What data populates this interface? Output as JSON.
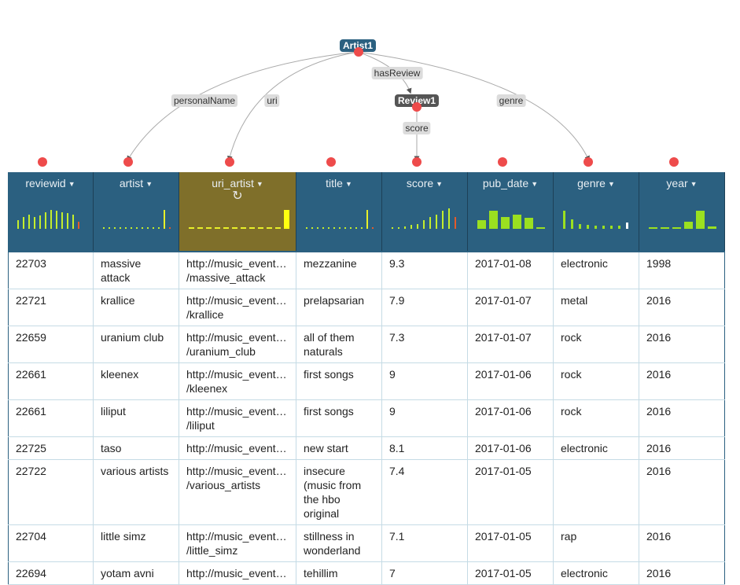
{
  "graph": {
    "nodes": [
      {
        "id": "artist1",
        "label": "Artist1",
        "color": "#2b6080"
      },
      {
        "id": "review1",
        "label": "Review1",
        "color": "#555555"
      }
    ],
    "edge_labels": [
      "personalName",
      "uri",
      "hasReview",
      "genre",
      "score"
    ]
  },
  "table": {
    "columns": [
      {
        "key": "reviewid",
        "label": "reviewid",
        "hist": [
          0.35,
          0.5,
          0.6,
          0.5,
          0.55,
          0.7,
          0.8,
          0.75,
          0.7,
          0.65,
          0.6,
          0.3
        ],
        "hist_colors": [
          "#c4ee2c",
          "#c4ee2c",
          "#c4ee2c",
          "#c4ee2c",
          "#c4ee2c",
          "#c4ee2c",
          "#c4ee2c",
          "#c4ee2c",
          "#c4ee2c",
          "#c4ee2c",
          "#c4ee2c",
          "#e55a2a"
        ],
        "style": "thin"
      },
      {
        "key": "artist",
        "label": "artist",
        "hist": [
          0.08,
          0.08,
          0.08,
          0.08,
          0.08,
          0.08,
          0.08,
          0.08,
          0.08,
          0.08,
          0.08,
          0.8,
          0.05
        ],
        "hist_colors": [
          "#c4ee2c",
          "#c4ee2c",
          "#c4ee2c",
          "#c4ee2c",
          "#c4ee2c",
          "#c4ee2c",
          "#c4ee2c",
          "#c4ee2c",
          "#c4ee2c",
          "#c4ee2c",
          "#c4ee2c",
          "#e8f029",
          "#e55a2a"
        ],
        "style": "thin"
      },
      {
        "key": "uri_artist",
        "label": "uri_artist",
        "hist": [
          0.08,
          0.08,
          0.08,
          0.08,
          0.08,
          0.08,
          0.08,
          0.08,
          0.08,
          0.08,
          0.08,
          0.8
        ],
        "hist_colors": [
          "#e8f029",
          "#e8f029",
          "#e8f029",
          "#e8f029",
          "#e8f029",
          "#e8f029",
          "#e8f029",
          "#e8f029",
          "#e8f029",
          "#e8f029",
          "#e8f029",
          "#ffff10"
        ],
        "style": "dash",
        "highlight": true
      },
      {
        "key": "title",
        "label": "title",
        "hist": [
          0.08,
          0.08,
          0.08,
          0.08,
          0.08,
          0.08,
          0.08,
          0.08,
          0.08,
          0.08,
          0.08,
          0.8,
          0.05
        ],
        "hist_colors": [
          "#c4ee2c",
          "#c4ee2c",
          "#c4ee2c",
          "#c4ee2c",
          "#c4ee2c",
          "#c4ee2c",
          "#c4ee2c",
          "#c4ee2c",
          "#c4ee2c",
          "#c4ee2c",
          "#c4ee2c",
          "#e8f029",
          "#e55a2a"
        ],
        "style": "thin"
      },
      {
        "key": "score",
        "label": "score",
        "hist": [
          0.08,
          0.08,
          0.1,
          0.15,
          0.2,
          0.35,
          0.5,
          0.6,
          0.75,
          0.85,
          0.5
        ],
        "hist_colors": [
          "#c4ee2c",
          "#c4ee2c",
          "#c4ee2c",
          "#c4ee2c",
          "#c4ee2c",
          "#c4ee2c",
          "#c4ee2c",
          "#c4ee2c",
          "#c4ee2c",
          "#c4ee2c",
          "#e55a2a"
        ],
        "style": "thin"
      },
      {
        "key": "pub_date",
        "label": "pub_date",
        "hist": [
          0.35,
          0.75,
          0.5,
          0.6,
          0.45,
          0.05
        ],
        "hist_colors": [
          "#9be020",
          "#9be020",
          "#9be020",
          "#9be020",
          "#9be020",
          "#9be020"
        ],
        "style": "wide"
      },
      {
        "key": "genre",
        "label": "genre",
        "hist": [
          0.75,
          0.4,
          0.2,
          0.15,
          0.12,
          0.12,
          0.12,
          0.12,
          0.25
        ],
        "hist_colors": [
          "#9be020",
          "#9be020",
          "#9be020",
          "#9be020",
          "#9be020",
          "#9be020",
          "#9be020",
          "#9be020",
          "#ffffff"
        ],
        "style": "med"
      },
      {
        "key": "year",
        "label": "year",
        "hist": [
          0.08,
          0.08,
          0.08,
          0.3,
          0.75,
          0.1
        ],
        "hist_colors": [
          "#9be020",
          "#9be020",
          "#9be020",
          "#9be020",
          "#9be020",
          "#9be020"
        ],
        "style": "wide"
      }
    ],
    "rows": [
      {
        "reviewid": "22703",
        "artist": "massive attack",
        "uri_artist": [
          "http://music_event…",
          "/massive_attack"
        ],
        "title": "mezzanine",
        "score": "9.3",
        "pub_date": "2017-01-08",
        "genre": "electronic",
        "year": "1998"
      },
      {
        "reviewid": "22721",
        "artist": "krallice",
        "uri_artist": [
          "http://music_event…",
          "/krallice"
        ],
        "title": "prelapsarian",
        "score": "7.9",
        "pub_date": "2017-01-07",
        "genre": "metal",
        "year": "2016"
      },
      {
        "reviewid": "22659",
        "artist": "uranium club",
        "uri_artist": [
          "http://music_event…",
          "/uranium_club"
        ],
        "title": "all of them naturals",
        "score": "7.3",
        "pub_date": "2017-01-07",
        "genre": "rock",
        "year": "2016"
      },
      {
        "reviewid": "22661",
        "artist": "kleenex",
        "uri_artist": [
          "http://music_event…",
          "/kleenex"
        ],
        "title": "first songs",
        "score": "9",
        "pub_date": "2017-01-06",
        "genre": "rock",
        "year": "2016"
      },
      {
        "reviewid": "22661",
        "artist": "liliput",
        "uri_artist": [
          "http://music_event…",
          "/liliput"
        ],
        "title": "first songs",
        "score": "9",
        "pub_date": "2017-01-06",
        "genre": "rock",
        "year": "2016"
      },
      {
        "reviewid": "22725",
        "artist": "taso",
        "uri_artist": [
          "http://music_event…"
        ],
        "title": "new start",
        "score": "8.1",
        "pub_date": "2017-01-06",
        "genre": "electronic",
        "year": "2016"
      },
      {
        "reviewid": "22722",
        "artist": "various artists",
        "uri_artist": [
          "http://music_event…",
          "/various_artists"
        ],
        "title": "insecure (music from the hbo original",
        "score": "7.4",
        "pub_date": "2017-01-05",
        "genre": "",
        "year": "2016"
      },
      {
        "reviewid": "22704",
        "artist": "little simz",
        "uri_artist": [
          "http://music_event…",
          "/little_simz"
        ],
        "title": "stillness in wonderland",
        "score": "7.1",
        "pub_date": "2017-01-05",
        "genre": "rap",
        "year": "2016"
      },
      {
        "reviewid": "22694",
        "artist": "yotam avni",
        "uri_artist": [
          "http://music_event…",
          ""
        ],
        "title": "tehillim",
        "score": "7",
        "pub_date": "2017-01-05",
        "genre": "electronic",
        "year": "2016"
      }
    ]
  }
}
